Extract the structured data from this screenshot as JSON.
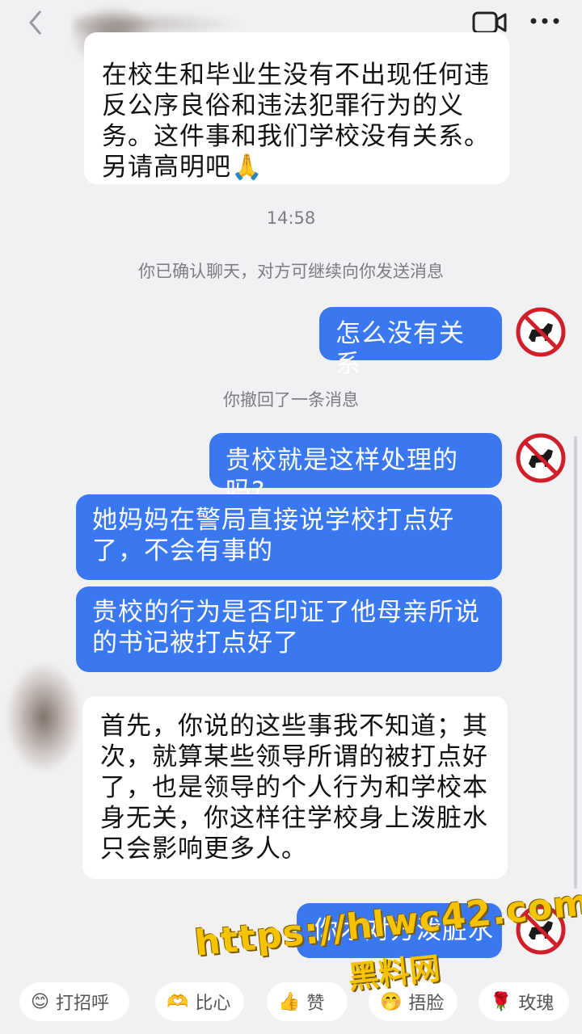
{
  "header": {
    "back_icon": "chevron-left-icon",
    "contact_name": "",
    "video_icon": "video-call-icon",
    "more_icon": "more-dots-icon"
  },
  "messages": {
    "m1": "在校生和毕业生没有不出现任何违反公序良俗和违法犯罪行为的义务。这件事和我们学校没有关系。另请高明吧🙏",
    "timestamp": "14:58",
    "confirm_note": "你已确认聊天，对方可继续向你发送消息",
    "m2": "怎么没有关系",
    "recall_note": "你撤回了一条消息",
    "m3": "贵校就是这样处理的吗?",
    "m4": "她妈妈在警局直接说学校打点好了，不会有事的",
    "m5": "贵校的行为是否印证了他母亲所说的书记被打点好了",
    "m6": "首先，你说的这些事我不知道；其次，就算某些领导所谓的被打点好了，也是领导的个人行为和学校本身无关，你这样往学校身上泼脏水只会影响更多人。",
    "m7": "你才对方泼脏水"
  },
  "quick_replies": [
    {
      "emoji": "😊",
      "label": "打招呼"
    },
    {
      "emoji": "🫶",
      "label": "比心"
    },
    {
      "emoji": "👍",
      "label": "赞"
    },
    {
      "emoji": "🤭",
      "label": "捂脸"
    },
    {
      "emoji": "🌹",
      "label": "玫瑰"
    }
  ],
  "watermark": {
    "url": "https://hlwc42.com",
    "name": "黑料网"
  },
  "colors": {
    "outgoing_bubble": "#3a78f2",
    "incoming_bubble": "#ffffff",
    "background": "#f1f1f3",
    "watermark": "#f5c300"
  }
}
